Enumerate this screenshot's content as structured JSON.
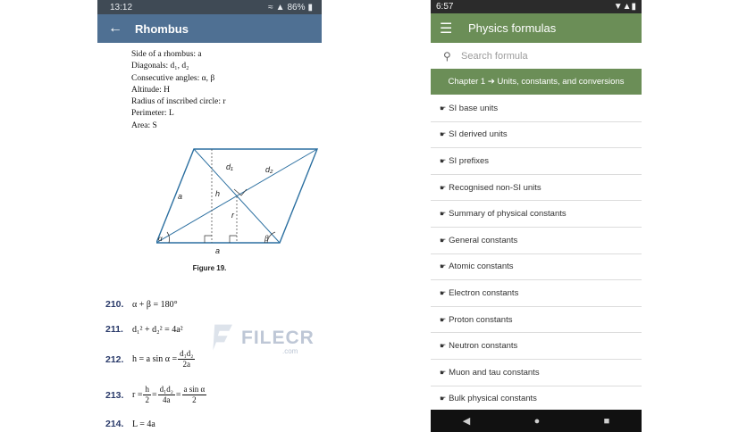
{
  "left_phone": {
    "status": {
      "time": "13:12",
      "battery": "86%"
    },
    "appbar": {
      "title": "Rhombus"
    },
    "properties": [
      "Side of a rhombus: a",
      "Diagonals: d₁, d₂",
      "Consecutive angles: α, β",
      "Altitude: H",
      "Radius of inscribed circle: r",
      "Perimeter: L",
      "Area: S"
    ],
    "figure": {
      "labels": {
        "a_left": "a",
        "a_bottom": "a",
        "h": "h",
        "r": "r",
        "d1": "d₁",
        "d2": "d₂",
        "alpha": "α",
        "beta": "β"
      },
      "caption": "Figure 19."
    },
    "formulas": [
      {
        "num": "210.",
        "text": "α + β = 180°"
      },
      {
        "num": "211.",
        "text": "d₁² + d₂² = 4a²"
      },
      {
        "num": "212.",
        "lhs": "h = a sin α =",
        "frac_top": "d₁d₂",
        "frac_bot": "2a"
      },
      {
        "num": "213.",
        "lhs": "r =",
        "f1_top": "h",
        "f1_bot": "2",
        "f2_top": "d₁d₂",
        "f2_bot": "4a",
        "f3_top": "a sin α",
        "f3_bot": "2"
      },
      {
        "num": "214.",
        "text": "L = 4a"
      }
    ]
  },
  "watermark": {
    "brand": "FILECR",
    "suffix": ".com"
  },
  "right_phone": {
    "status": {
      "time": "6:57"
    },
    "appbar": {
      "title": "Physics formulas"
    },
    "search": {
      "placeholder": "Search formula"
    },
    "chapter": "Chapter 1 ➔ Units, constants, and conversions",
    "items": [
      "SI base units",
      "SI derived units",
      "SI prefixes",
      "Recognised non-SI units",
      "Summary of physical constants",
      "General constants",
      "Atomic constants",
      "Electron constants",
      "Proton constants",
      "Neutron constants",
      "Muon and tau constants",
      "Bulk physical constants"
    ],
    "navbar": {
      "back": "◀",
      "home": "●",
      "recents": "■"
    }
  },
  "colors": {
    "left_appbar": "#4f7093",
    "right_appbar": "#6b8e57",
    "chapter_bg": "#6b8e57"
  },
  "icons": [
    "back-arrow-icon",
    "menu-icon",
    "search-icon",
    "hand-pointer-icon",
    "wifi-icon",
    "signal-icon",
    "battery-icon"
  ]
}
